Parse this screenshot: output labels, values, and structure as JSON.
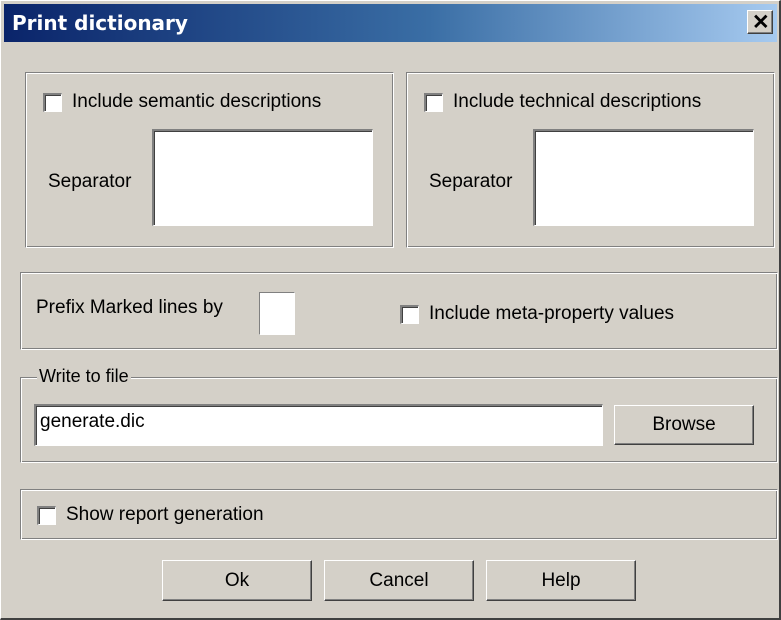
{
  "dialog": {
    "title": "Print dictionary",
    "close_glyph": "✕",
    "close_icon": "close-icon"
  },
  "semantic_group": {
    "checkbox_label": "Include semantic descriptions",
    "checked": false,
    "separator_label": "Separator",
    "separator_value": ""
  },
  "technical_group": {
    "checkbox_label": "Include technical descriptions",
    "checked": false,
    "separator_label": "Separator",
    "separator_value": ""
  },
  "options": {
    "prefix_label": "Prefix Marked lines by",
    "prefix_value": "",
    "meta_label": "Include meta-property values",
    "meta_checked": false
  },
  "write_to_file": {
    "legend": "Write to file",
    "file_value": "generate.dic",
    "browse_label": "Browse"
  },
  "report": {
    "checkbox_label": "Show report generation",
    "checked": false
  },
  "buttons": {
    "ok_label": "Ok",
    "cancel_label": "Cancel",
    "help_label": "Help"
  }
}
